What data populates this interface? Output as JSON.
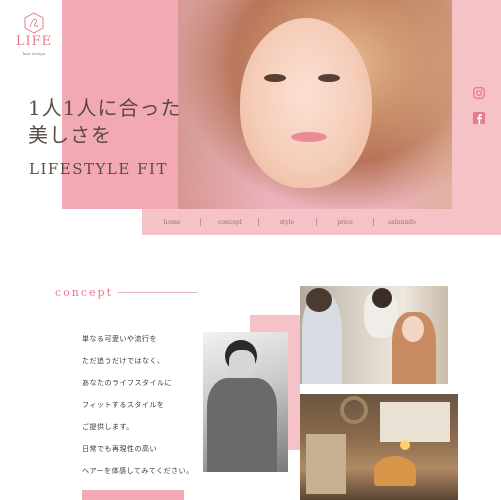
{
  "logo": {
    "name": "LIFE",
    "sub": "hair design"
  },
  "hero": {
    "catch_line1": "1人1人に合った",
    "catch_line2": "美しさを",
    "tagline": "LIFESTYLE FIT"
  },
  "nav": {
    "items": [
      "home",
      "concept",
      "style",
      "price",
      "saloninfo"
    ]
  },
  "social": {
    "icons": [
      "instagram-icon",
      "facebook-icon"
    ]
  },
  "concept": {
    "title": "concept",
    "lines": [
      "単なる可愛いや流行を",
      "ただ追うだけではなく、",
      "あなたのライフスタイルに",
      "フィットするスタイルを",
      "ご提供します。",
      "日常でも再現性の高い",
      "ヘアーを体感してみてください。"
    ]
  },
  "colors": {
    "accent_pink": "#f2a9b4",
    "light_pink": "#f5c2c8",
    "title_pink": "#e87a8c",
    "text": "#5a4a44"
  }
}
